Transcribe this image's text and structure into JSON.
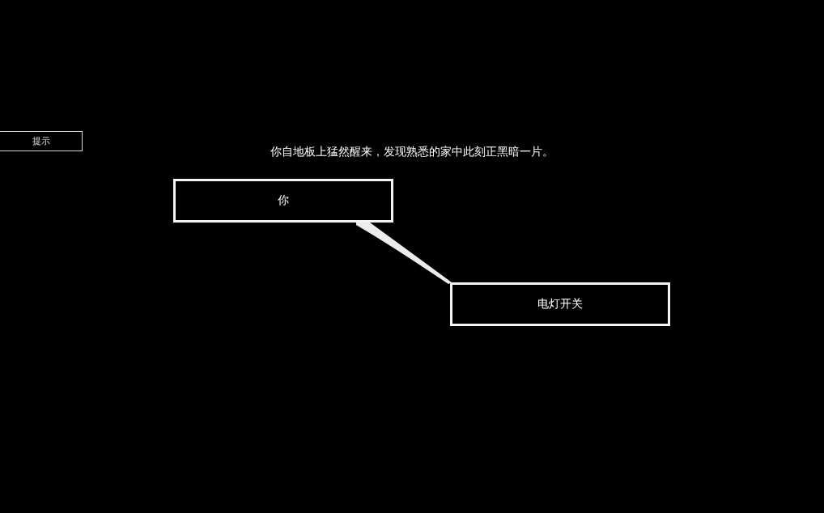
{
  "hint_button": {
    "label": "提示"
  },
  "narration": "你自地板上猛然醒来，发现熟悉的家中此刻正黑暗一片。",
  "nodes": [
    {
      "label": "你"
    },
    {
      "label": "电灯开关"
    }
  ]
}
